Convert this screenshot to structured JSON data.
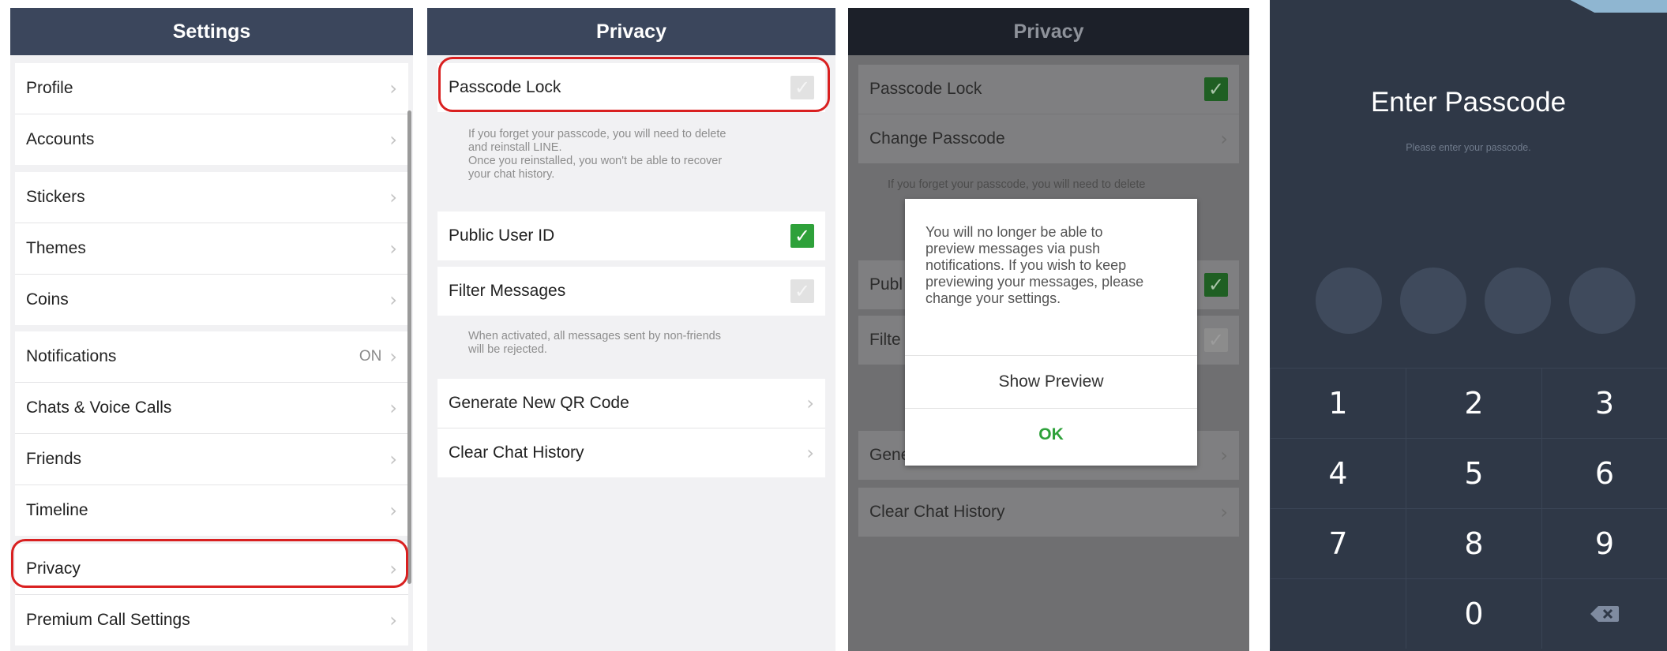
{
  "settings_panel": {
    "title": "Settings",
    "items": [
      {
        "label": "Profile"
      },
      {
        "label": "Accounts"
      },
      {
        "label": "Stickers"
      },
      {
        "label": "Themes"
      },
      {
        "label": "Coins"
      },
      {
        "label": "Notifications",
        "value": "ON"
      },
      {
        "label": "Chats & Voice Calls"
      },
      {
        "label": "Friends"
      },
      {
        "label": "Timeline"
      },
      {
        "label": "Privacy",
        "highlighted": true
      },
      {
        "label": "Premium Call Settings"
      }
    ]
  },
  "privacy_panel": {
    "title": "Privacy",
    "passcode_lock": {
      "label": "Passcode Lock",
      "checked": false,
      "highlighted": true
    },
    "passcode_hint": "If you forget your passcode, you will need to delete\nand reinstall LINE.\nOnce you reinstalled, you won't be able to recover\nyour chat history.",
    "public_user_id": {
      "label": "Public User ID",
      "checked": true
    },
    "filter_messages": {
      "label": "Filter Messages",
      "checked": false
    },
    "filter_hint": "When activated, all messages sent by non-friends\nwill be rejected.",
    "generate_qr": "Generate New QR Code",
    "clear_history": "Clear Chat History"
  },
  "privacy_dialog_panel": {
    "title": "Privacy",
    "passcode_lock": {
      "label": "Passcode Lock",
      "checked": true
    },
    "change_passcode": "Change Passcode",
    "passcode_hint": "If you forget your passcode, you will need to delete",
    "public_user_id_partial": "Publ",
    "filter_partial": "Filte",
    "generate_partial": "Gene",
    "clear_history": "Clear Chat History",
    "dialog": {
      "message": "You will no longer be able to\npreview messages via push\nnotifications. If you wish to keep\npreviewing your messages, please\nchange your settings.",
      "show_preview": "Show Preview",
      "ok": "OK"
    }
  },
  "passcode_panel": {
    "title": "Enter Passcode",
    "subtitle": "Please enter your passcode.",
    "keys": [
      "1",
      "2",
      "3",
      "4",
      "5",
      "6",
      "7",
      "8",
      "9",
      "",
      "0",
      "⌫"
    ]
  },
  "colors": {
    "header": "#3b465c",
    "check_on": "#2ea13a",
    "highlight_ring": "#d92020",
    "dialog_ok": "#2ea13a",
    "passcode_bg": "#2f3847"
  }
}
